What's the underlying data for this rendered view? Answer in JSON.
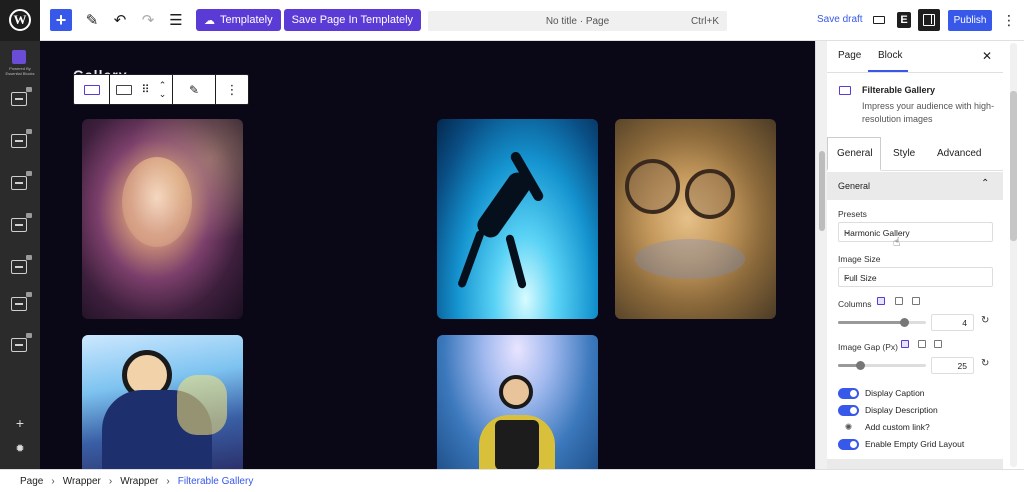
{
  "topbar": {
    "templately_label": "Templately",
    "save_templately_label": "Save Page In Templately",
    "doc_title": "No title · Page",
    "shortcut": "Ctrl+K",
    "save_draft": "Save draft",
    "publish": "Publish"
  },
  "leftbar": {
    "logo_text": "Powered By Essential Blocks"
  },
  "canvas": {
    "heading_ghost": "Gallery"
  },
  "inspector": {
    "tabs": [
      "Page",
      "Block"
    ],
    "active_tab": "Block",
    "block_name": "Filterable Gallery",
    "block_description": "Impress your audience with high-resolution images",
    "sub_tabs": [
      "General",
      "Style",
      "Advanced"
    ],
    "section_title": "General",
    "presets_label": "Presets",
    "presets_value": "Harmonic Gallery",
    "image_size_label": "Image Size",
    "image_size_value": "Full Size",
    "columns_label": "Columns",
    "columns_value": "4",
    "image_gap_label": "Image Gap (Px)",
    "image_gap_value": "25",
    "toggles": {
      "display_caption": "Display Caption",
      "display_description": "Display Description",
      "add_custom_link": "Add custom link?",
      "enable_empty_grid": "Enable Empty Grid Layout"
    }
  },
  "breadcrumb": [
    "Page",
    "Wrapper",
    "Wrapper",
    "Filterable Gallery"
  ],
  "colors": {
    "accent": "#3858e9",
    "brand_purple": "#5b3bd6",
    "canvas_bg": "#0a0716"
  }
}
